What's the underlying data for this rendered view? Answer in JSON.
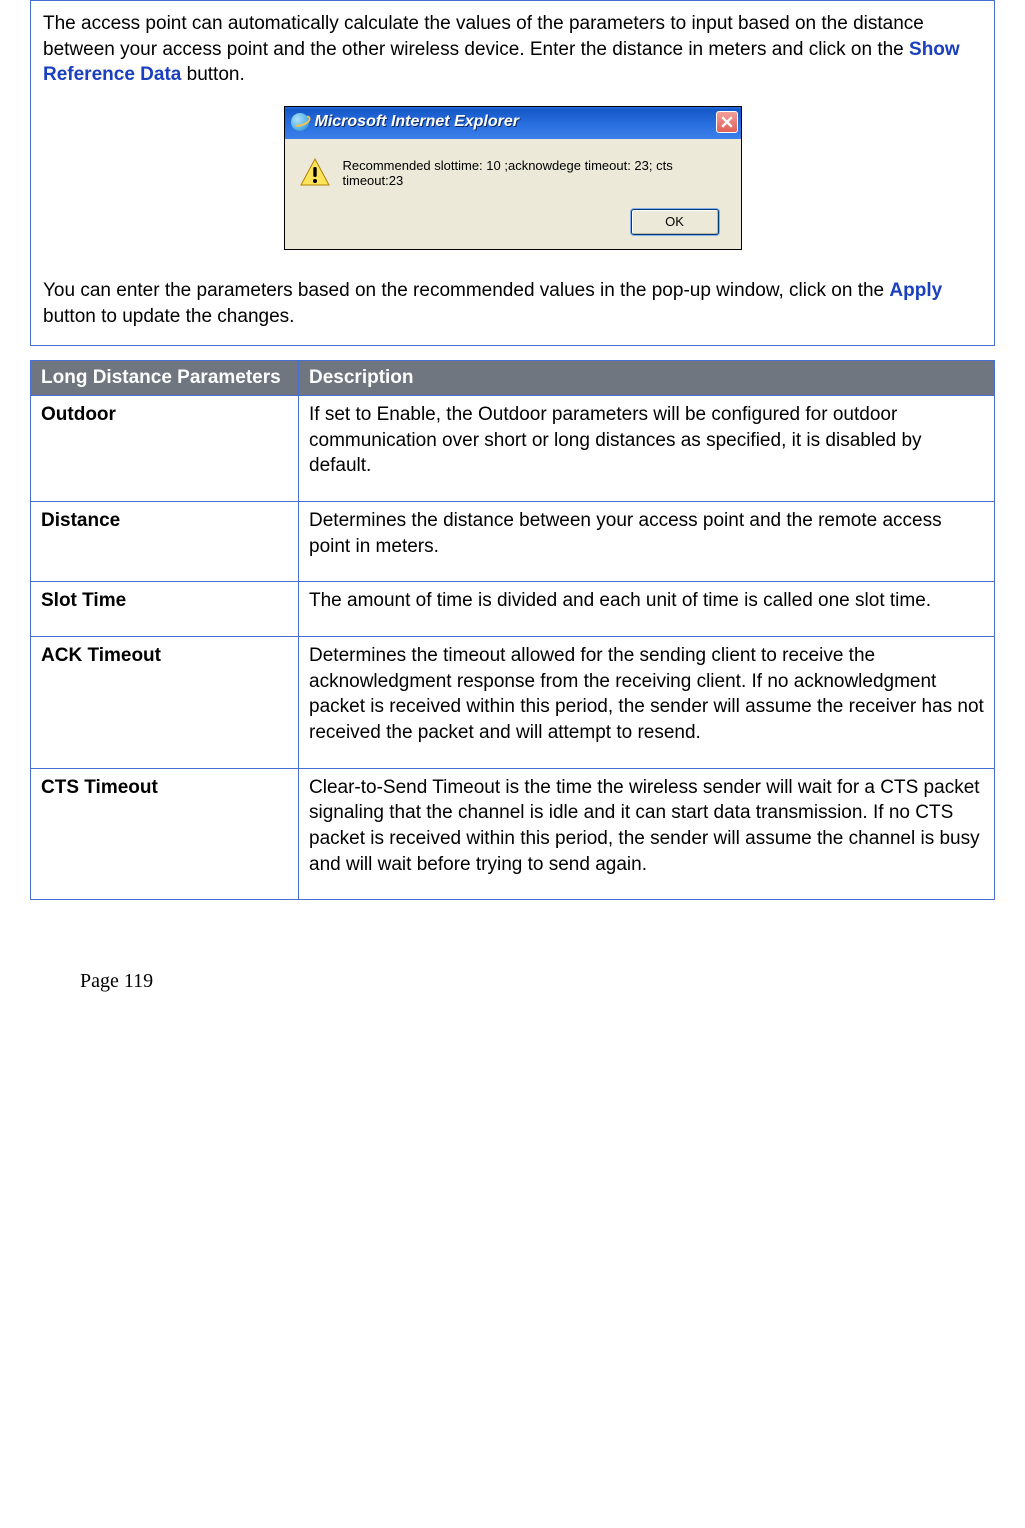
{
  "intro": {
    "para1_before": "The access point can automatically calculate the values of the parameters to input based on the distance between your access point and the other wireless device. Enter the distance in meters and click on the ",
    "show_ref": "Show Reference Data",
    "para1_after": " button.",
    "para2_before": "You can enter the parameters based on the recommended values in the pop-up window, click on the ",
    "apply": "Apply",
    "para2_after": " button to update the changes."
  },
  "dialog": {
    "title": "Microsoft Internet Explorer",
    "message": "Recommended slottime: 10 ;acknowdege timeout: 23; cts timeout:23",
    "ok": "OK"
  },
  "table": {
    "head_param": "Long Distance Parameters",
    "head_desc": "Description",
    "rows": [
      {
        "name": "Outdoor",
        "desc": "If set to Enable, the Outdoor parameters will be configured for outdoor communication over short or long distances as specified, it is disabled by default."
      },
      {
        "name": "Distance",
        "desc": "Determines the distance between your access point and the remote access point in meters."
      },
      {
        "name": "Slot Time",
        "desc": "The amount of time is divided and each unit of time is called one slot time."
      },
      {
        "name": "ACK Timeout",
        "desc": "Determines the timeout allowed for the sending client to receive the acknowledgment response from the receiving client. If no acknowledgment packet is received within this period, the sender will assume the receiver has not received the packet and will attempt to resend."
      },
      {
        "name": "CTS Timeout",
        "desc": "Clear-to-Send Timeout is the time the wireless sender will wait for a CTS packet signaling that the channel is idle and it can start data transmission. If no CTS packet is received within this period, the sender will assume the channel is busy and will wait before trying to send again."
      }
    ]
  },
  "page_number": "Page 119"
}
